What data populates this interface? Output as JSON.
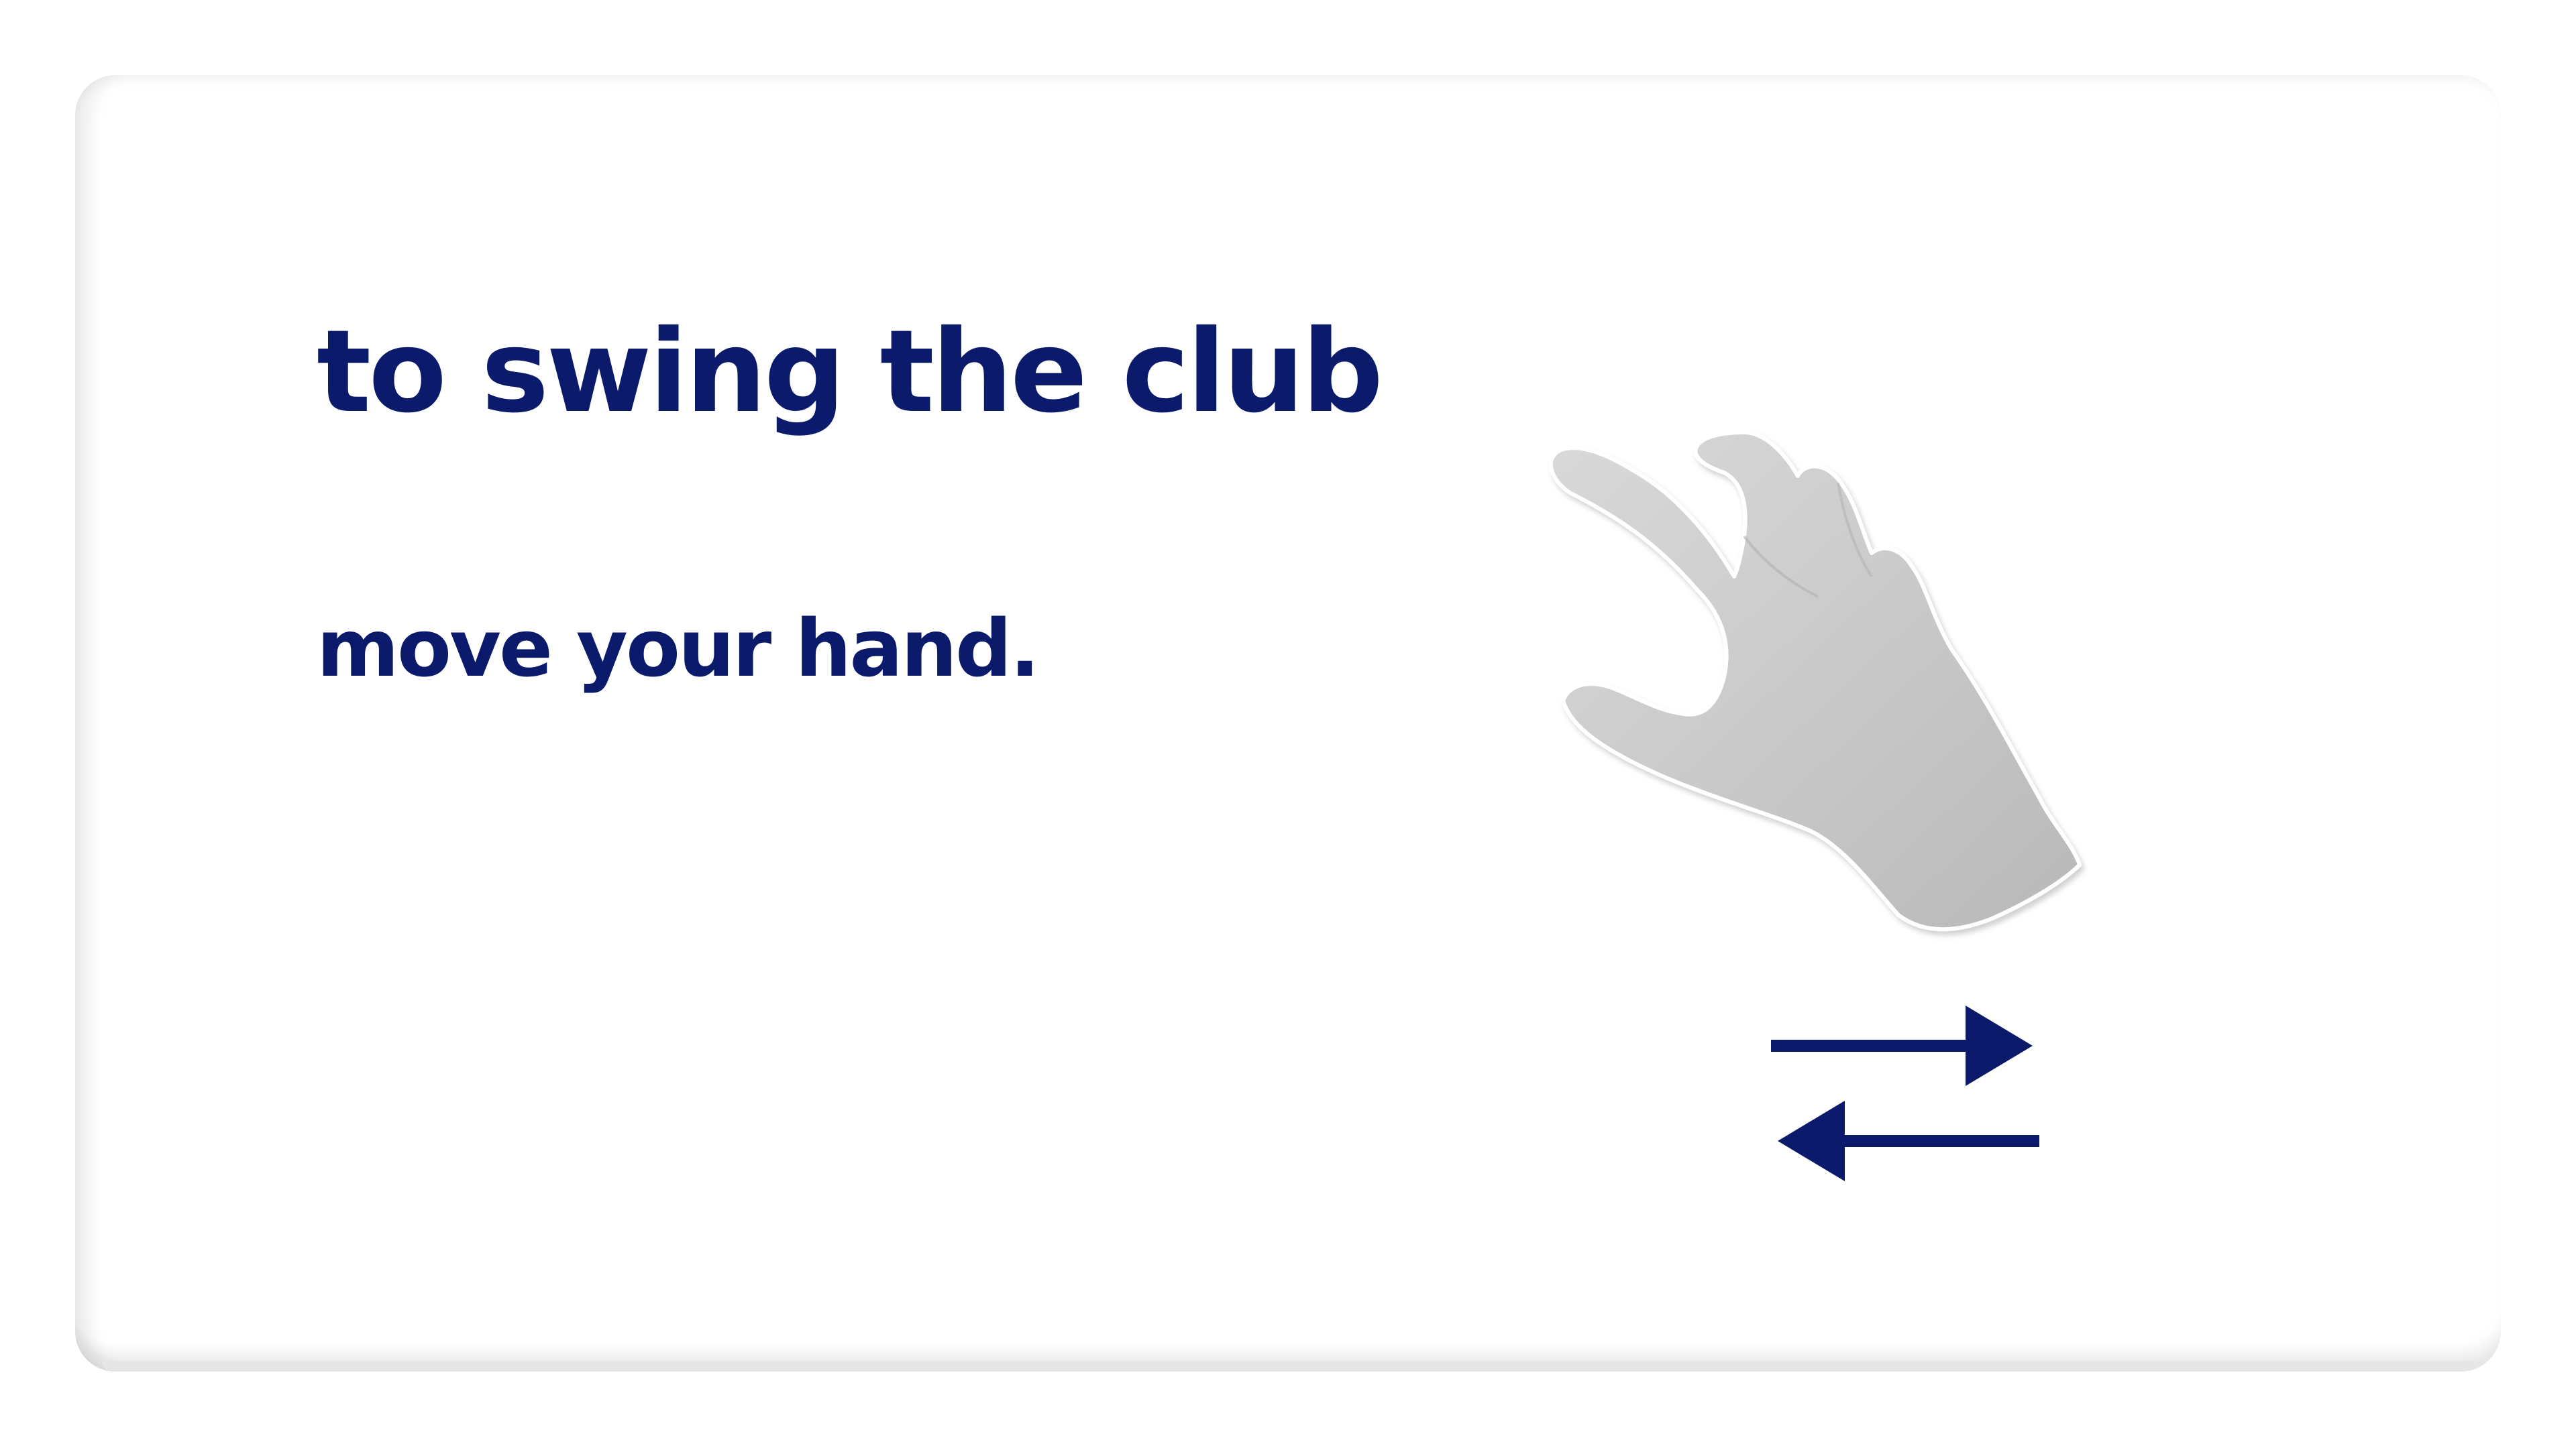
{
  "instruction": {
    "title": "to swing the club",
    "subtitle": "move your hand."
  },
  "illustration": {
    "hand_icon": "hand-icon",
    "arrows_icon": "left-right-arrows-icon"
  },
  "colors": {
    "text": "#0b1a6b",
    "arrow": "#0b1a6b",
    "hand": "#c9c9c9",
    "background": "#ffffff"
  }
}
